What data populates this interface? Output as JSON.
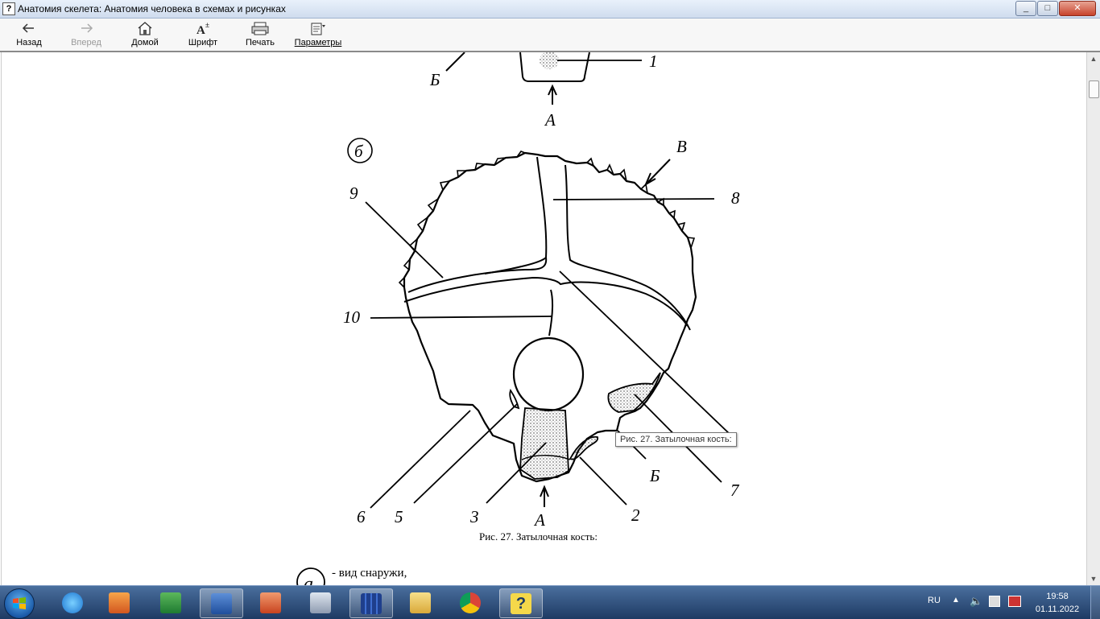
{
  "window": {
    "title": "Анатомия скелета: Анатомия человека в схемах и рисунках",
    "app_icon": "help-book-icon",
    "controls": {
      "minimize": "_",
      "maximize": "□",
      "close": "✕"
    }
  },
  "toolbar": {
    "back_label": "Назад",
    "forward_label": "Вперед",
    "home_label": "Домой",
    "font_label": "Шрифт",
    "print_label": "Печать",
    "options_label": "Параметры"
  },
  "figure": {
    "top_labels": {
      "b_cyr": "Б",
      "one": "1",
      "a_top": "А"
    },
    "section_label": "б",
    "labels": {
      "v": "В",
      "eight": "8",
      "nine": "9",
      "ten": "10",
      "six": "6",
      "five": "5",
      "three": "3",
      "a_bottom": "А",
      "two": "2",
      "b_bottom": "Б",
      "seven": "7"
    },
    "caption": "Рис. 27. Затылочная кость:",
    "tooltip": "Рис. 27. Затылочная кость:"
  },
  "legend": {
    "marker": "а",
    "text": "- вид снаружи,"
  },
  "taskbar": {
    "apps": [
      "ie-icon",
      "media-player-icon",
      "excel-icon",
      "word-icon",
      "powerpoint-icon",
      "calculator-icon",
      "books-icon",
      "file-explorer-icon",
      "chrome-icon",
      "help-icon"
    ],
    "language": "RU",
    "time": "19:58",
    "date": "01.11.2022"
  }
}
